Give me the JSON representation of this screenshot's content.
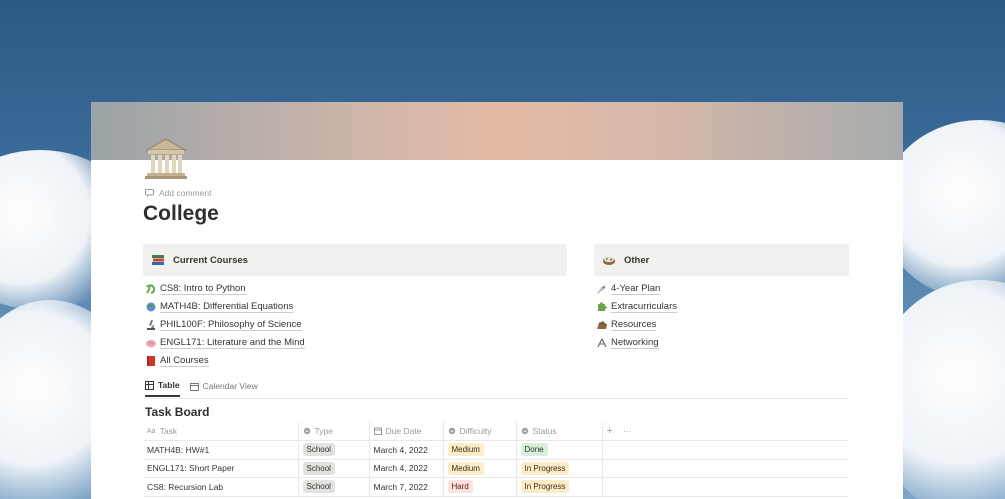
{
  "page": {
    "title": "College",
    "add_comment": "Add comment",
    "icon": "classical-building-icon"
  },
  "columns": [
    {
      "heading": "Current Courses",
      "icon": "books-icon",
      "items": [
        {
          "label": "CS8: Intro to Python",
          "icon": "snake-icon"
        },
        {
          "label": "MATH4B: Differential Equations",
          "icon": "globe-icon"
        },
        {
          "label": "PHIL100F: Philosophy of Science",
          "icon": "microscope-icon"
        },
        {
          "label": "ENGL171: Literature and the Mind",
          "icon": "brain-icon"
        },
        {
          "label": "All Courses",
          "icon": "red-book-icon"
        }
      ]
    },
    {
      "heading": "Other",
      "icon": "bento-box-icon",
      "items": [
        {
          "label": "4-Year Plan",
          "icon": "rocket-icon"
        },
        {
          "label": "Extracurriculars",
          "icon": "puzzle-icon"
        },
        {
          "label": "Resources",
          "icon": "rock-icon"
        },
        {
          "label": "Networking",
          "icon": "link-icon"
        }
      ]
    }
  ],
  "tabs": [
    {
      "label": "Table",
      "icon": "table-icon",
      "active": true
    },
    {
      "label": "Calendar View",
      "icon": "calendar-icon",
      "active": false
    }
  ],
  "board": {
    "title": "Task Board",
    "headers": {
      "task": "Task",
      "type": "Type",
      "due": "Due Date",
      "difficulty": "Difficulty",
      "status": "Status",
      "add": "+",
      "more": "···"
    },
    "rows": [
      {
        "task": "MATH4B: HW#1",
        "type": "School",
        "due": "March 4, 2022",
        "difficulty": "Medium",
        "status": "Done"
      },
      {
        "task": "ENGL171: Short Paper",
        "type": "School",
        "due": "March 4, 2022",
        "difficulty": "Medium",
        "status": "In Progress"
      },
      {
        "task": "CS8: Recursion Lab",
        "type": "School",
        "due": "March 7, 2022",
        "difficulty": "Hard",
        "status": "In Progress"
      }
    ]
  },
  "colors": {
    "tag_gray": "#e3e2e0",
    "tag_medium": "#fdecc8",
    "tag_hard": "#ffe2dd",
    "tag_done": "#dbeddb",
    "tag_in_progress": "#fdecc8"
  }
}
